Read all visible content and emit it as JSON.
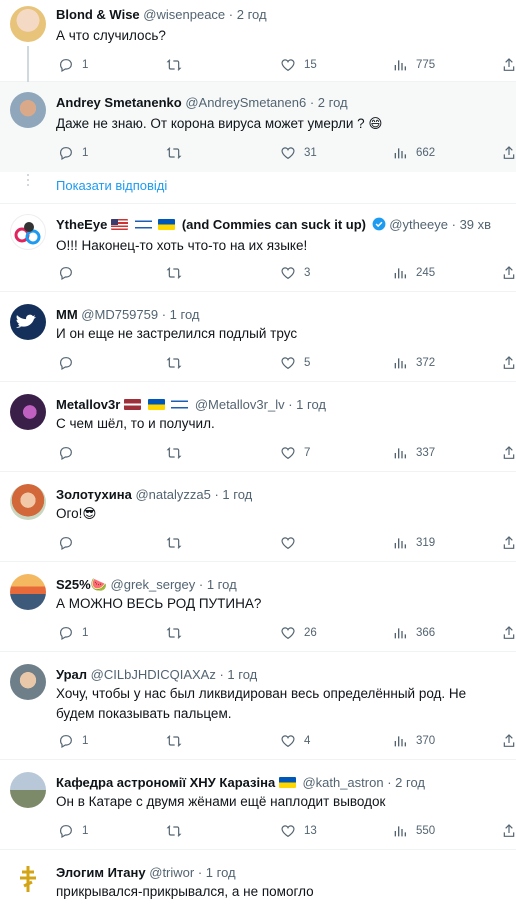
{
  "tweets": [
    {
      "name": "Blond & Wise",
      "handle": "@wisenpeace",
      "time": "· 2 год",
      "text": "А что случилось?",
      "replies": "1",
      "retweets": "",
      "likes": "15",
      "views": "775"
    },
    {
      "name": "Andrey Smetanenko",
      "handle": "@AndreySmetanen6",
      "time": "· 2 год",
      "text": "Даже не знаю. От корона вируса может умерли ? 😄",
      "replies": "1",
      "retweets": "",
      "likes": "31",
      "views": "662"
    },
    {
      "name": "YtheEye",
      "name_suffix": "(and Commies can suck it up)",
      "handle": "@ytheeye",
      "time": "· 39 хв",
      "text": "О!!! Наконец-то хоть что-то на их языке!",
      "replies": "",
      "retweets": "",
      "likes": "3",
      "views": "245"
    },
    {
      "name": "MM",
      "handle": "@MD759759",
      "time": "· 1 год",
      "text": "И он еще не застрелился подлый трус",
      "replies": "",
      "retweets": "",
      "likes": "5",
      "views": "372"
    },
    {
      "name": "Metallov3r",
      "handle": "@Metallov3r_lv",
      "time": "· 1 год",
      "text": "С чем шёл, то и получил.",
      "replies": "",
      "retweets": "",
      "likes": "7",
      "views": "337"
    },
    {
      "name": "Золотухина",
      "handle": "@natalyzza5",
      "time": "· 1 год",
      "text": "Ого!😎",
      "replies": "",
      "retweets": "",
      "likes": "",
      "views": "319"
    },
    {
      "name": "S25%🍉",
      "handle": "@grek_sergey",
      "time": "· 1 год",
      "text": "А МОЖНО ВЕСЬ РОД ПУТИНА?",
      "replies": "1",
      "retweets": "",
      "likes": "26",
      "views": "366"
    },
    {
      "name": "Урал",
      "handle": "@CILbJHDICQIAXAz",
      "time": "· 1 год",
      "text": "Хочу, чтобы у нас был ликвидирован весь определённый род. Не будем показывать пальцем.",
      "replies": "1",
      "retweets": "",
      "likes": "4",
      "views": "370"
    },
    {
      "name": "Кафедра астрономії ХНУ Каразіна",
      "handle": "@kath_astron",
      "time": "· 2 год",
      "text": "Он в Катаре с двумя жёнами ещё наплодит выводок",
      "replies": "1",
      "retweets": "",
      "likes": "13",
      "views": "550"
    },
    {
      "name": "Элогим Итану",
      "handle": "@triwor",
      "time": "· 1 год",
      "text": "прикрывался-прикрывался, а не помогло",
      "replies": "",
      "retweets": "",
      "likes": "",
      "views": ""
    }
  ],
  "show_replies_label": "Показати відповіді",
  "icons": [
    "reply-icon",
    "retweet-icon",
    "like-icon",
    "views-icon",
    "share-icon",
    "verified-badge-icon"
  ],
  "colors": {
    "text": "#0f1419",
    "secondary": "#536471",
    "link": "#1d9bf0",
    "divider": "#eff3f4",
    "highlight_bg": "#f7f9f9"
  }
}
